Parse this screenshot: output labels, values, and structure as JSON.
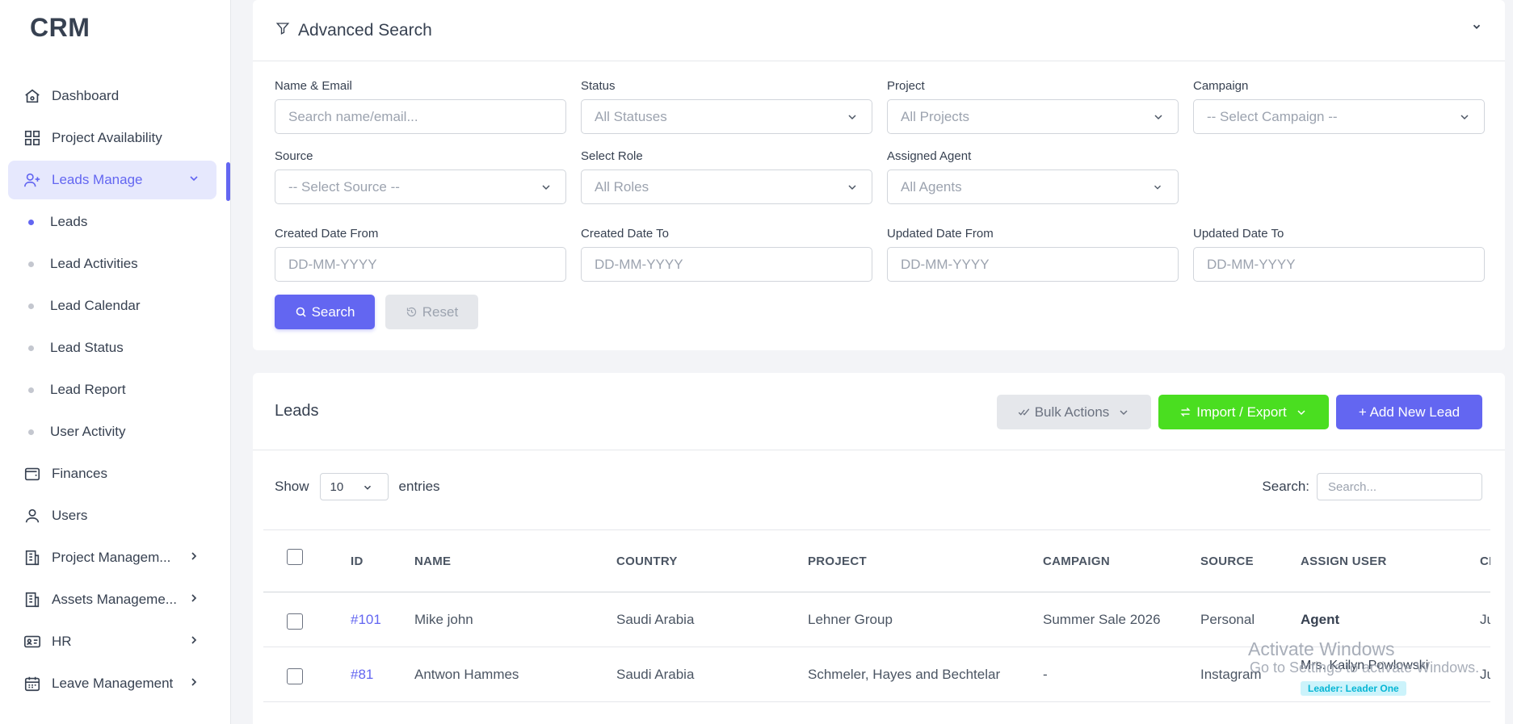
{
  "brand": "CRM",
  "sidebar": {
    "items": [
      {
        "label": "Dashboard"
      },
      {
        "label": "Project Availability"
      },
      {
        "label": "Leads Manage"
      },
      {
        "label": "Finances"
      },
      {
        "label": "Users"
      },
      {
        "label": "Project Managem..."
      },
      {
        "label": "Assets Manageme..."
      },
      {
        "label": "HR"
      },
      {
        "label": "Leave Management"
      }
    ],
    "sub_items": [
      {
        "label": "Leads"
      },
      {
        "label": "Lead Activities"
      },
      {
        "label": "Lead Calendar"
      },
      {
        "label": "Lead Status"
      },
      {
        "label": "Lead Report"
      },
      {
        "label": "User Activity"
      }
    ]
  },
  "search_panel": {
    "title": "Advanced Search",
    "fields": {
      "name_email": {
        "label": "Name & Email",
        "placeholder": "Search name/email..."
      },
      "status": {
        "label": "Status",
        "value": "All Statuses"
      },
      "project": {
        "label": "Project",
        "value": "All Projects"
      },
      "campaign": {
        "label": "Campaign",
        "value": "-- Select Campaign --"
      },
      "source": {
        "label": "Source",
        "value": "-- Select Source --"
      },
      "role": {
        "label": "Select Role",
        "value": "All Roles"
      },
      "agent": {
        "label": "Assigned Agent",
        "value": "All Agents"
      },
      "created_from": {
        "label": "Created Date From",
        "placeholder": "DD-MM-YYYY"
      },
      "created_to": {
        "label": "Created Date To",
        "placeholder": "DD-MM-YYYY"
      },
      "updated_from": {
        "label": "Updated Date From",
        "placeholder": "DD-MM-YYYY"
      },
      "updated_to": {
        "label": "Updated Date To",
        "placeholder": "DD-MM-YYYY"
      }
    },
    "search_label": "Search",
    "reset_label": "Reset"
  },
  "leads": {
    "title": "Leads",
    "bulk_label": "Bulk Actions",
    "import_label": "Import / Export",
    "add_label": "+ Add New Lead",
    "show_label": "Show",
    "entries_value": "10",
    "entries_label": "entries",
    "search_label": "Search:",
    "search_placeholder": "Search...",
    "columns": [
      "ID",
      "NAME",
      "COUNTRY",
      "PROJECT",
      "CAMPAIGN",
      "SOURCE",
      "ASSIGN USER",
      "CR"
    ],
    "rows": [
      {
        "id": "#101",
        "name": "Mike john",
        "country": "Saudi Arabia",
        "project": "Lehner Group",
        "campaign": "Summer Sale 2026",
        "source": "Personal",
        "assign": "Agent",
        "badge": "",
        "cr": "Ju"
      },
      {
        "id": "#81",
        "name": "Antwon Hammes",
        "country": "Saudi Arabia",
        "project": "Schmeler, Hayes and Bechtelar",
        "campaign": "-",
        "source": "Instagram",
        "assign": "Mrs. Kailyn Powlowski",
        "badge": "Leader: Leader One",
        "cr": "Ju"
      }
    ]
  },
  "watermark": {
    "line1": "Activate Windows",
    "line2": "Go to Settings to activate Windows."
  },
  "colors": {
    "accent": "#6366f1",
    "green": "#4ade20",
    "badge_bg": "#ccf3fb"
  }
}
